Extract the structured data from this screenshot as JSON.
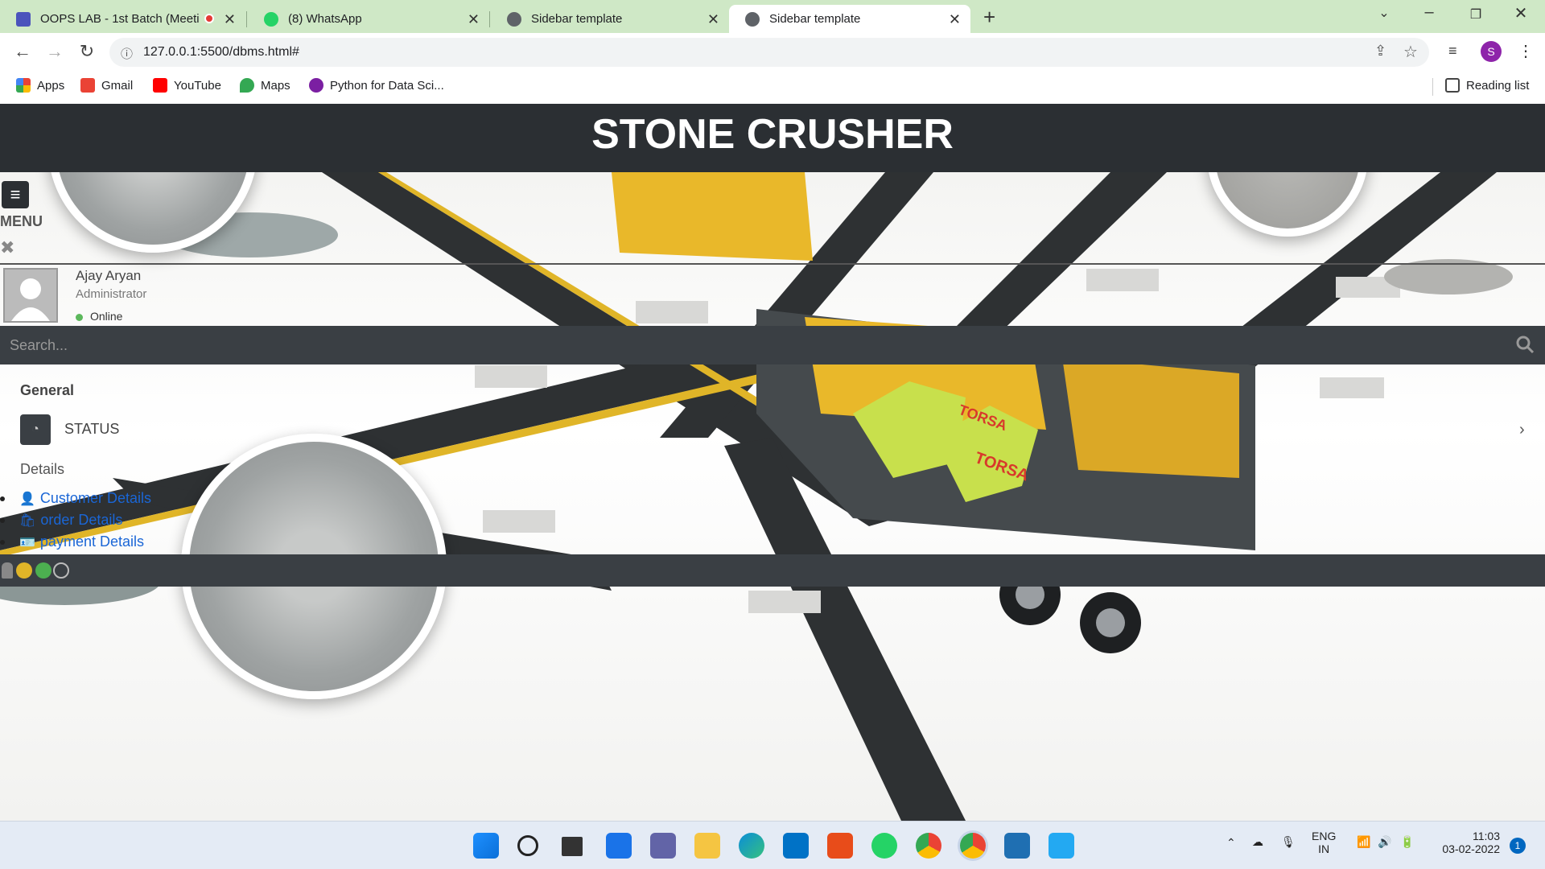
{
  "browser": {
    "tabs": [
      {
        "title": "OOPS LAB - 1st Batch (Meeti",
        "favicon_color": "#4b53bc",
        "recording": true
      },
      {
        "title": "(8) WhatsApp",
        "favicon_color": "#25d366"
      },
      {
        "title": "Sidebar template",
        "favicon_color": "#5f6368"
      },
      {
        "title": "Sidebar template",
        "favicon_color": "#5f6368",
        "active": true
      }
    ],
    "url": "127.0.0.1:5500/dbms.html#",
    "profile_initial": "S",
    "bookmarks": [
      "Apps",
      "Gmail",
      "YouTube",
      "Maps",
      "Python for Data Sci..."
    ],
    "reading_list": "Reading list"
  },
  "page": {
    "title": "STONE CRUSHER",
    "menu_label": "MENU",
    "user": {
      "name": "Ajay Aryan",
      "role": "Administrator",
      "status": "Online"
    },
    "search_placeholder": "Search...",
    "general_label": "General",
    "status_label": "STATUS",
    "details_label": "Details",
    "details_links": [
      "Customer Details",
      "order Details",
      "payment Details"
    ],
    "watermark": "TORSA"
  },
  "taskbar": {
    "language": "ENG",
    "region": "IN",
    "time": "11:03",
    "date": "03-02-2022",
    "notification_count": "1"
  }
}
